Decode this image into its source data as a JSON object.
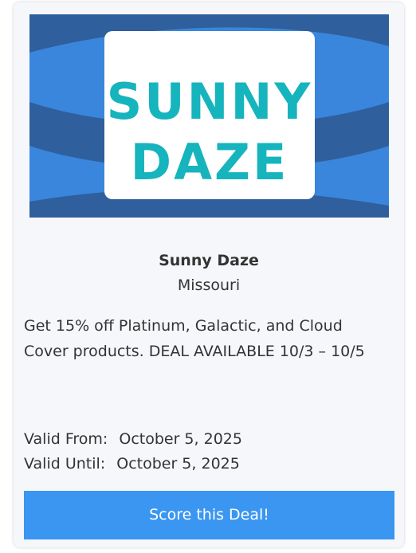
{
  "deal": {
    "logo_line1": "SUNNY",
    "logo_line2": "DAZE",
    "name": "Sunny Daze",
    "state": "Missouri",
    "description": "Get 15% off Platinum, Galactic, and Cloud Cover products. DEAL AVAILABLE 10/3 – 10/5",
    "valid_from_label": "Valid From:",
    "valid_from_value": "October 5, 2025",
    "valid_until_label": "Valid Until:",
    "valid_until_value": "October 5, 2025",
    "cta_label": "Score this Deal!"
  },
  "colors": {
    "banner_blue": "#3a86dc",
    "banner_dark_band": "#2f5f9c",
    "logo_teal": "#16b4bd",
    "button_blue": "#3a96f0",
    "card_bg": "#f5f7fb"
  }
}
